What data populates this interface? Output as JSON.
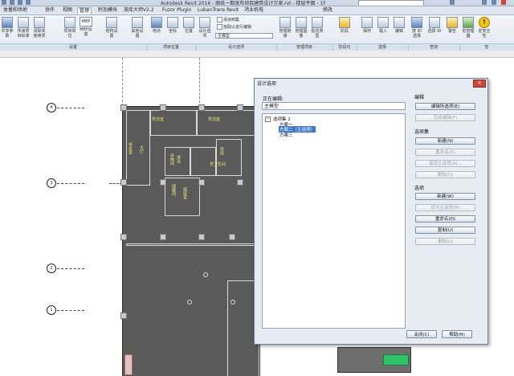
{
  "window": {
    "title": "Autodesk Revit 2016 - 图纸一期发布项目建筑设计方案.rvt - 楼层平面 - 1F"
  },
  "menu_tabs": [
    "体量和场地",
    "协作",
    "视图",
    "管理",
    "附加模块",
    "族库大师V2.2",
    "Fuzor Plugin",
    "LubanTrans Revit",
    "鸿业机电",
    "修改"
  ],
  "ribbon": {
    "buttons": [
      {
        "label": "共享参数",
        "icon": "shared-params-icon"
      },
      {
        "label": "传递项目标准",
        "icon": "transfer-icon"
      },
      {
        "label": "清除未使用项",
        "icon": "purge-icon"
      },
      {
        "label": "项目单位",
        "icon": "units-icon"
      },
      {
        "label": "MEP设置",
        "icon": "mep-icon"
      },
      {
        "label": "结构设置",
        "icon": "structural-icon"
      },
      {
        "label": "其他设置",
        "icon": "settings-icon"
      },
      {
        "label": "地点",
        "icon": "location-icon"
      },
      {
        "label": "坐标",
        "icon": "coordinates-icon"
      },
      {
        "label": "位置",
        "icon": "position-icon"
      },
      {
        "label": "设计选项",
        "icon": "design-options-icon"
      },
      {
        "label": "管理链接",
        "icon": "manage-links-icon"
      },
      {
        "label": "管理图像",
        "icon": "manage-images-icon"
      },
      {
        "label": "贴花类型",
        "icon": "decal-icon"
      },
      {
        "label": "阶段",
        "icon": "phases-icon"
      },
      {
        "label": "保存",
        "icon": "save-selection-icon"
      },
      {
        "label": "载入",
        "icon": "load-selection-icon"
      },
      {
        "label": "编辑",
        "icon": "edit-selection-icon"
      },
      {
        "label": "按 ID 选择",
        "icon": "select-id-icon"
      },
      {
        "label": "选择 ID",
        "icon": "ids-icon"
      },
      {
        "label": "警告",
        "icon": "warnings-icon"
      },
      {
        "label": "宏管理器",
        "icon": "macro-manager-icon"
      },
      {
        "label": "宏安全性",
        "icon": "macro-security-icon"
      }
    ],
    "small_items": [
      "添加到集",
      "拾取以进行编辑"
    ],
    "main_model_select": "主模型",
    "panels": [
      "设置",
      "项目位置",
      "设计选项",
      "管理项目",
      "阶段化",
      "选择",
      "查询",
      "宏"
    ]
  },
  "canvas": {
    "grid_labels": [
      "4",
      "3",
      "2",
      "1"
    ],
    "room_labels": [
      "男浴室",
      "男浴室",
      "休息室",
      "大厅",
      "杂物间",
      "淋浴",
      "男卫生间",
      "储藏间",
      "值班室",
      "库房"
    ]
  },
  "dialog": {
    "title": "设计选项",
    "editing_label": "正在编辑:",
    "current_value": "主模型",
    "tree": {
      "set_name": "选项集 1",
      "options": [
        {
          "label": "方案一",
          "selected": false
        },
        {
          "label": "方案二（主选项）",
          "selected": true
        },
        {
          "label": "方案三",
          "selected": false
        }
      ]
    },
    "edit_section": {
      "title": "编辑",
      "buttons": [
        {
          "label": "编辑所选项(E)",
          "enabled": true
        },
        {
          "label": "完成编辑(F)",
          "enabled": false
        }
      ]
    },
    "option_set_section": {
      "title": "选项集",
      "buttons": [
        {
          "label": "新建(N)",
          "enabled": true
        },
        {
          "label": "重命名(R)",
          "enabled": false
        },
        {
          "label": "接受主选项(A)...",
          "enabled": false
        },
        {
          "label": "删除(D)",
          "enabled": false
        }
      ]
    },
    "option_section": {
      "title": "选项",
      "buttons": [
        {
          "label": "新建(W)",
          "enabled": true
        },
        {
          "label": "设为主选项(M)",
          "enabled": false
        },
        {
          "label": "重命名(O)",
          "enabled": true
        },
        {
          "label": "复制(U)",
          "enabled": true
        },
        {
          "label": "删除(L)",
          "enabled": false
        }
      ]
    },
    "close_label": "关闭(C)",
    "help_label": "帮助(H)"
  }
}
